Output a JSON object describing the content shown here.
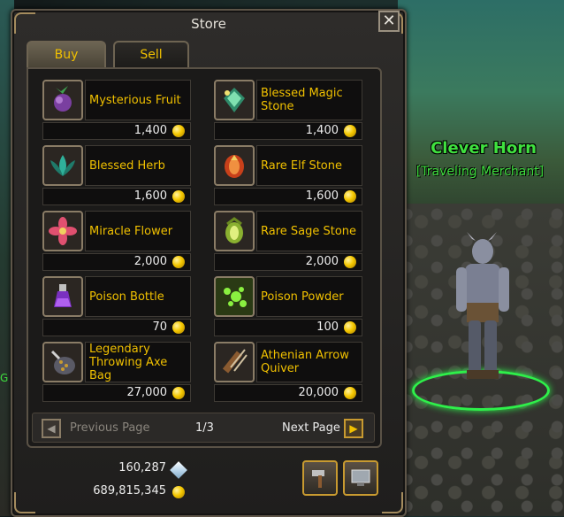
{
  "window": {
    "title": "Store",
    "close_glyph": "✕"
  },
  "tabs": [
    {
      "label": "Buy",
      "active": true
    },
    {
      "label": "Sell",
      "active": false
    }
  ],
  "items": [
    {
      "name": "Mysterious Fruit",
      "price": "1,400",
      "icon": "fruit-icon"
    },
    {
      "name": "Blessed Magic Stone",
      "price": "1,400",
      "icon": "magic-stone-icon"
    },
    {
      "name": "Blessed Herb",
      "price": "1,600",
      "icon": "herb-icon"
    },
    {
      "name": "Rare Elf Stone",
      "price": "1,600",
      "icon": "elf-stone-icon"
    },
    {
      "name": "Miracle Flower",
      "price": "2,000",
      "icon": "flower-icon"
    },
    {
      "name": "Rare Sage Stone",
      "price": "2,000",
      "icon": "sage-stone-icon"
    },
    {
      "name": "Poison Bottle",
      "price": "70",
      "icon": "poison-bottle-icon"
    },
    {
      "name": "Poison Powder",
      "price": "100",
      "icon": "poison-powder-icon"
    },
    {
      "name": "Legendary Throwing Axe Bag",
      "price": "27,000",
      "icon": "axe-bag-icon"
    },
    {
      "name": "Athenian Arrow Quiver",
      "price": "20,000",
      "icon": "quiver-icon"
    }
  ],
  "pager": {
    "previous_label": "Previous Page",
    "page": "1/3",
    "next_label": "Next Page"
  },
  "wallet": {
    "gems": "160,287",
    "gold": "689,815,345"
  },
  "npc": {
    "name": "Clever Horn",
    "title": "[Traveling Merchant]"
  },
  "colors": {
    "item_text": "#f0c000",
    "npc_text": "#3fe03f"
  }
}
